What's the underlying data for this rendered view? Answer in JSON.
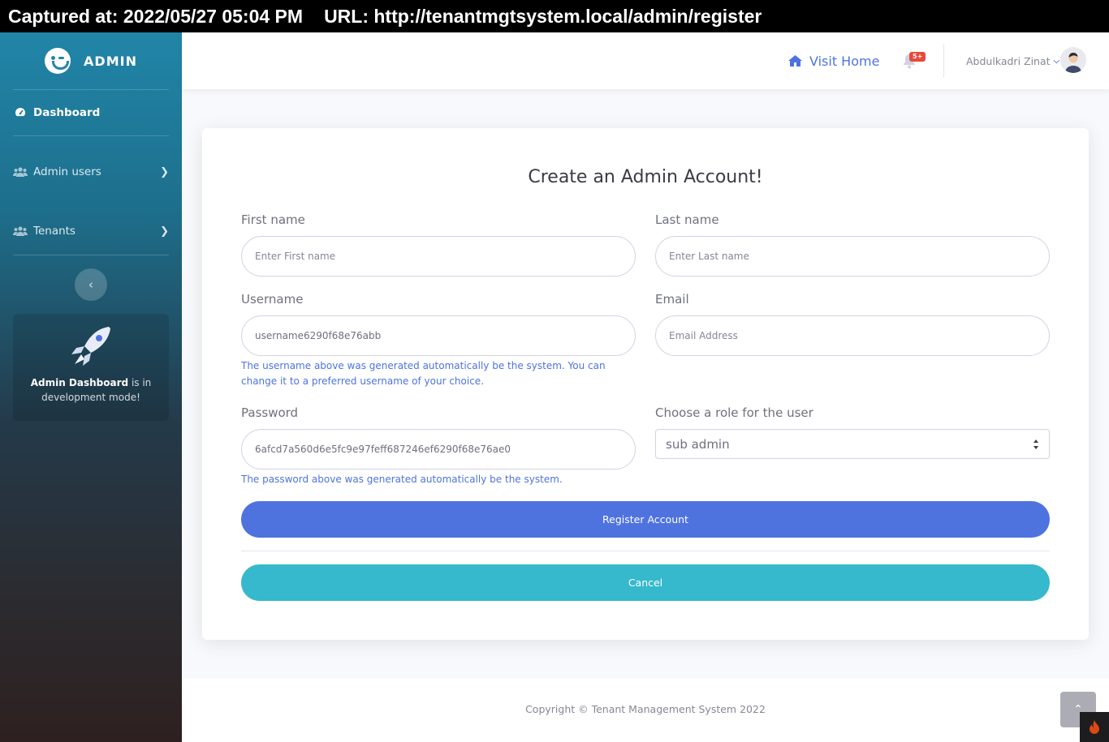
{
  "capture": {
    "captured_at": "Captured at: 2022/05/27 05:04 PM",
    "url": "URL: http://tenantmgtsystem.local/admin/register"
  },
  "sidebar": {
    "brand": "ADMIN",
    "items": [
      {
        "label": "Dashboard",
        "icon": "tachometer-icon"
      },
      {
        "label": "Admin users",
        "icon": "users-icon"
      },
      {
        "label": "Tenants",
        "icon": "users-icon"
      }
    ],
    "promo": {
      "bold": "Admin Dashboard",
      "rest": " is in development mode!"
    }
  },
  "topbar": {
    "visit_home": "Visit Home",
    "notification_badge": "5+",
    "user_name": "Abdulkadri Zinat"
  },
  "form": {
    "title": "Create an Admin Account!",
    "first_name": {
      "label": "First name",
      "placeholder": "Enter First name",
      "value": ""
    },
    "last_name": {
      "label": "Last name",
      "placeholder": "Enter Last name",
      "value": ""
    },
    "username": {
      "label": "Username",
      "value": "username6290f68e76abb",
      "help": "The username above was generated automatically be the system. You can change it to a preferred username of your choice."
    },
    "email": {
      "label": "Email",
      "placeholder": "Email Address",
      "value": ""
    },
    "password": {
      "label": "Password",
      "value": "6afcd7a560d6e5fc9e97feff687246ef6290f68e76ae0",
      "help": "The password above was generated automatically be the system."
    },
    "role": {
      "label": "Choose a role for the user",
      "selected": "sub admin"
    },
    "register_label": "Register Account",
    "cancel_label": "Cancel"
  },
  "footer": {
    "copyright": "Copyright © Tenant Management System 2022"
  },
  "colors": {
    "primary": "#4e73df",
    "info": "#36b9cc",
    "danger": "#e74a3b",
    "sidebar_top": "#2185a8"
  }
}
